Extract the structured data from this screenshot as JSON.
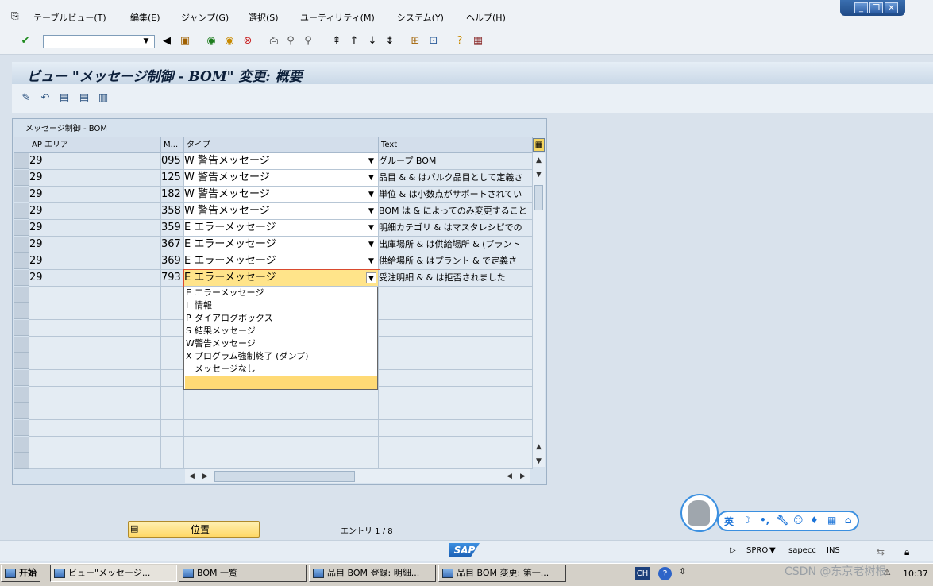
{
  "menu": [
    "テーブルビュー(T)",
    "編集(E)",
    "ジャンプ(G)",
    "選択(S)",
    "ユーティリティ(M)",
    "システム(Y)",
    "ヘルプ(H)"
  ],
  "window_controls": [
    "minimize-icon",
    "restore-icon",
    "close-icon"
  ],
  "title": "ビュー \"メッセージ制御 - BOM\" 変更: 概要",
  "table": {
    "title": "メッセージ制御 - BOM",
    "columns": [
      "AP エリア",
      "M...",
      "タイプ",
      "Text"
    ],
    "rows": [
      {
        "area": "29",
        "msg": "095",
        "type_code": "W",
        "type_text": "警告メッセージ",
        "text": "グループ BOM"
      },
      {
        "area": "29",
        "msg": "125",
        "type_code": "W",
        "type_text": "警告メッセージ",
        "text": "品目 & & はバルク品目として定義さ"
      },
      {
        "area": "29",
        "msg": "182",
        "type_code": "W",
        "type_text": "警告メッセージ",
        "text": "単位 & は小数点がサポートされてい"
      },
      {
        "area": "29",
        "msg": "358",
        "type_code": "W",
        "type_text": "警告メッセージ",
        "text": "BOM は & によってのみ変更すること"
      },
      {
        "area": "29",
        "msg": "359",
        "type_code": "E",
        "type_text": "エラーメッセージ",
        "text": "明細カテゴリ & はマスタレシピでの"
      },
      {
        "area": "29",
        "msg": "367",
        "type_code": "E",
        "type_text": "エラーメッセージ",
        "text": "出庫場所 & は供給場所 & (プラント"
      },
      {
        "area": "29",
        "msg": "369",
        "type_code": "E",
        "type_text": "エラーメッセージ",
        "text": "供給場所 & はプラント & で定義さ"
      },
      {
        "area": "29",
        "msg": "793",
        "type_code": "E",
        "type_text": "エラーメッセージ",
        "text": "受注明細 & & は拒否されました"
      }
    ]
  },
  "dropdown": [
    {
      "code": "E",
      "label": "エラーメッセージ"
    },
    {
      "code": "I",
      "label": "情報"
    },
    {
      "code": "P",
      "label": "ダイアログボックス"
    },
    {
      "code": "S",
      "label": "結果メッセージ"
    },
    {
      "code": "W",
      "label": "警告メッセージ"
    },
    {
      "code": "X",
      "label": "プログラム強制終了 (ダンプ)"
    },
    {
      "code": "",
      "label": "メッセージなし"
    }
  ],
  "position_button": "位置",
  "entry": "エントリ 1 / 8",
  "sap_logo": "SAP",
  "status": {
    "transaction": "SPRO",
    "server": "sapecc",
    "mode": "INS"
  },
  "ime": {
    "lang": "英"
  },
  "taskbar": {
    "start": "开始",
    "tasks": [
      "ビュー\"メッセージ...",
      "BOM 一覧",
      "品目 BOM 登録: 明細...",
      "品目 BOM 変更: 第一..."
    ],
    "lang": "CH",
    "clock": "10:37"
  },
  "watermark": "CSDN @东京老树根"
}
